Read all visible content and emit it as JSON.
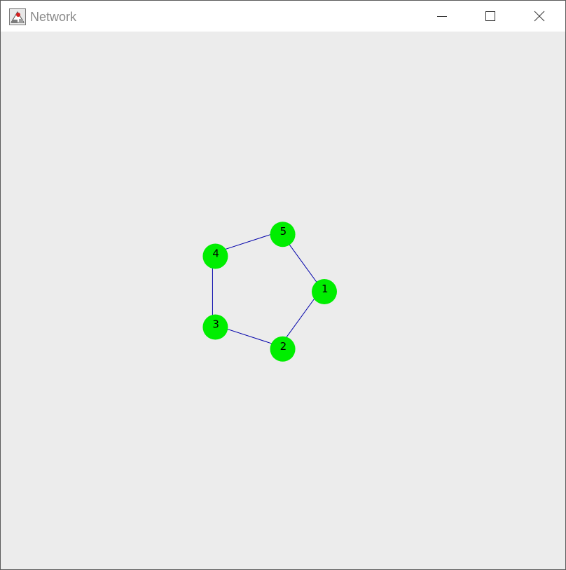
{
  "window": {
    "title": "Network",
    "app_icon": "java-icon",
    "controls": {
      "minimize_icon": "minimize-icon",
      "maximize_icon": "maximize-icon",
      "close_icon": "close-icon"
    }
  },
  "network": {
    "node_color": "#00ee00",
    "edge_color": "#0000aa",
    "nodes": [
      {
        "id": "1",
        "label": "1"
      },
      {
        "id": "2",
        "label": "2"
      },
      {
        "id": "3",
        "label": "3"
      },
      {
        "id": "4",
        "label": "4"
      },
      {
        "id": "5",
        "label": "5"
      }
    ],
    "edges": [
      {
        "from": "1",
        "to": "2"
      },
      {
        "from": "2",
        "to": "3"
      },
      {
        "from": "3",
        "to": "4"
      },
      {
        "from": "4",
        "to": "5"
      },
      {
        "from": "5",
        "to": "1"
      }
    ]
  }
}
